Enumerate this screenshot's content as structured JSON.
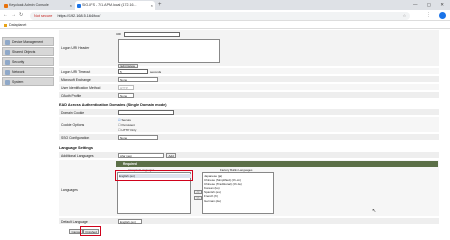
{
  "browser": {
    "tabs": [
      {
        "label": "Keycloak Admin Console",
        "color": "#e8710a"
      },
      {
        "label": "SIG-IFS - 7/1.APM.local (172.16...",
        "color": "#1a73e8"
      }
    ],
    "new_tab": "+",
    "security_label": "Not secure",
    "url": "https://192.168.5.164/tco/",
    "bookmark": "Dataplanet",
    "window_controls": "— ▢ ✕"
  },
  "sidebar": {
    "items": [
      {
        "label": "Device Management"
      },
      {
        "label": "Shared Objects"
      },
      {
        "label": "Security"
      },
      {
        "label": "Network"
      },
      {
        "label": "System"
      }
    ]
  },
  "form": {
    "logon_header_label": "Logon URI Header",
    "edit_label": "Edit",
    "delete_label": "Delete",
    "timeout_label": "Logon URI Timeout",
    "timeout_value": "5",
    "timeout_unit": "seconds",
    "exchange_label": "Microsoft Exchange",
    "exchange_value": "None",
    "user_ident_label": "User Identification Method",
    "user_ident_value": "HTTP",
    "oauth_label": "OAuth Profile",
    "oauth_value": "None"
  },
  "eda": {
    "header": "EAD Across Authentication Domains (Single Domain mode)",
    "domain_cookie_label": "Domain Cookie",
    "cookie_options_label": "Cookie Options",
    "cookie_options": [
      "Secure",
      "Persistent",
      "HTTP Only"
    ],
    "sso_label": "SSO Configuration",
    "sso_value": "None"
  },
  "language": {
    "header": "Language Settings",
    "additional_label": "Additional Languages",
    "additional_value": "Afar (aa)",
    "add_button": "Add",
    "required_header": "Required",
    "languages_label": "Languages",
    "accepted_header": "Accepted Languages",
    "accepted": [
      "English (en)"
    ],
    "factory_header": "Factory Builtin Languages",
    "factory": [
      "Japanese (ja)",
      "Chinese (Simplified) (zh-cn)",
      "Chinese (Traditional) (zh-tw)",
      "Korean (ko)",
      "Spanish (es)",
      "French (fr)",
      "German (de)"
    ],
    "move_left": "<<",
    "move_right": ">>",
    "default_label": "Default Language",
    "default_value": "English (en)"
  },
  "actions": {
    "cancel_label": "Cancel",
    "finished_label": "Finished"
  },
  "colors": {
    "highlight": "#d0021b",
    "required_bar": "#5b6f47"
  }
}
